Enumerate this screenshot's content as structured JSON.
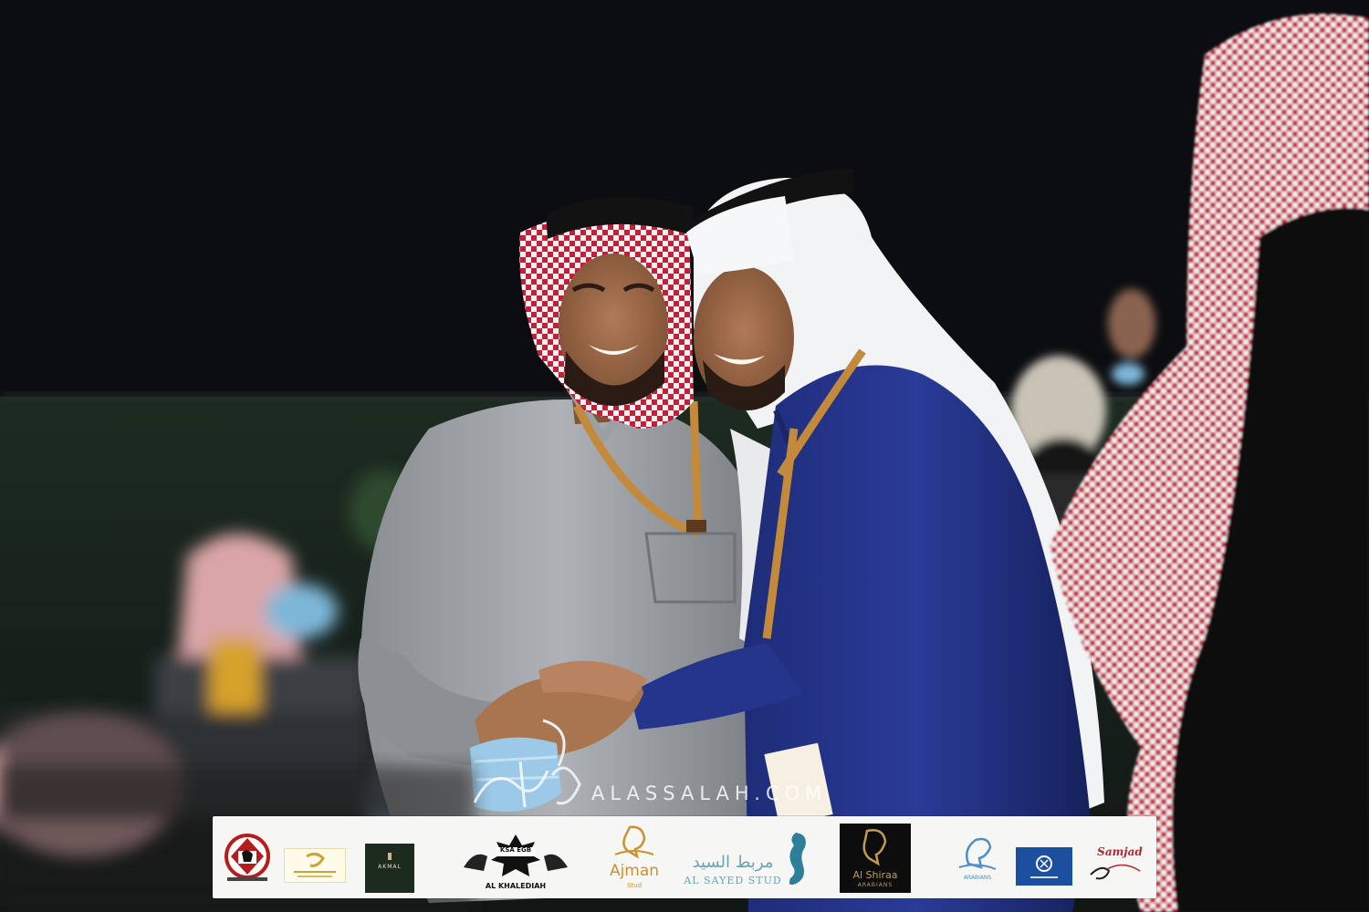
{
  "photo": {
    "watermark": "ALASSALAH.COM"
  },
  "sponsors": {
    "items": [
      {
        "id": "saudi-arabian-horse-society",
        "label": ""
      },
      {
        "id": "al-faisaliah-stud",
        "label": ""
      },
      {
        "id": "akmal",
        "label": "AKMAL"
      },
      {
        "id": "al-khalediah",
        "label": "AL KHALEDIAH",
        "sublabel": "KSA EGB"
      },
      {
        "id": "ajman-stud",
        "label": "Ajman",
        "sublabel": "Stud"
      },
      {
        "id": "al-sayed-stud",
        "label": "AL SAYED STUD",
        "arabic": "مربط السيد"
      },
      {
        "id": "al-shiraa",
        "label": "Al Shiraa",
        "sublabel": "ARABIANS"
      },
      {
        "id": "alkhalil-arabians",
        "label": "ARABIANS"
      },
      {
        "id": "al-khaldia-stud",
        "label": ""
      },
      {
        "id": "samjad",
        "label": "Samjad"
      }
    ]
  },
  "colors": {
    "backdrop": "#0c0d10",
    "thobe_grey": "#9fa3a7",
    "thobe_blue": "#23338a",
    "lanyard_gold": "#c48a3c",
    "shemagh_red": "#c0203a",
    "sponsor_bar_bg": "#f6f6f4"
  }
}
